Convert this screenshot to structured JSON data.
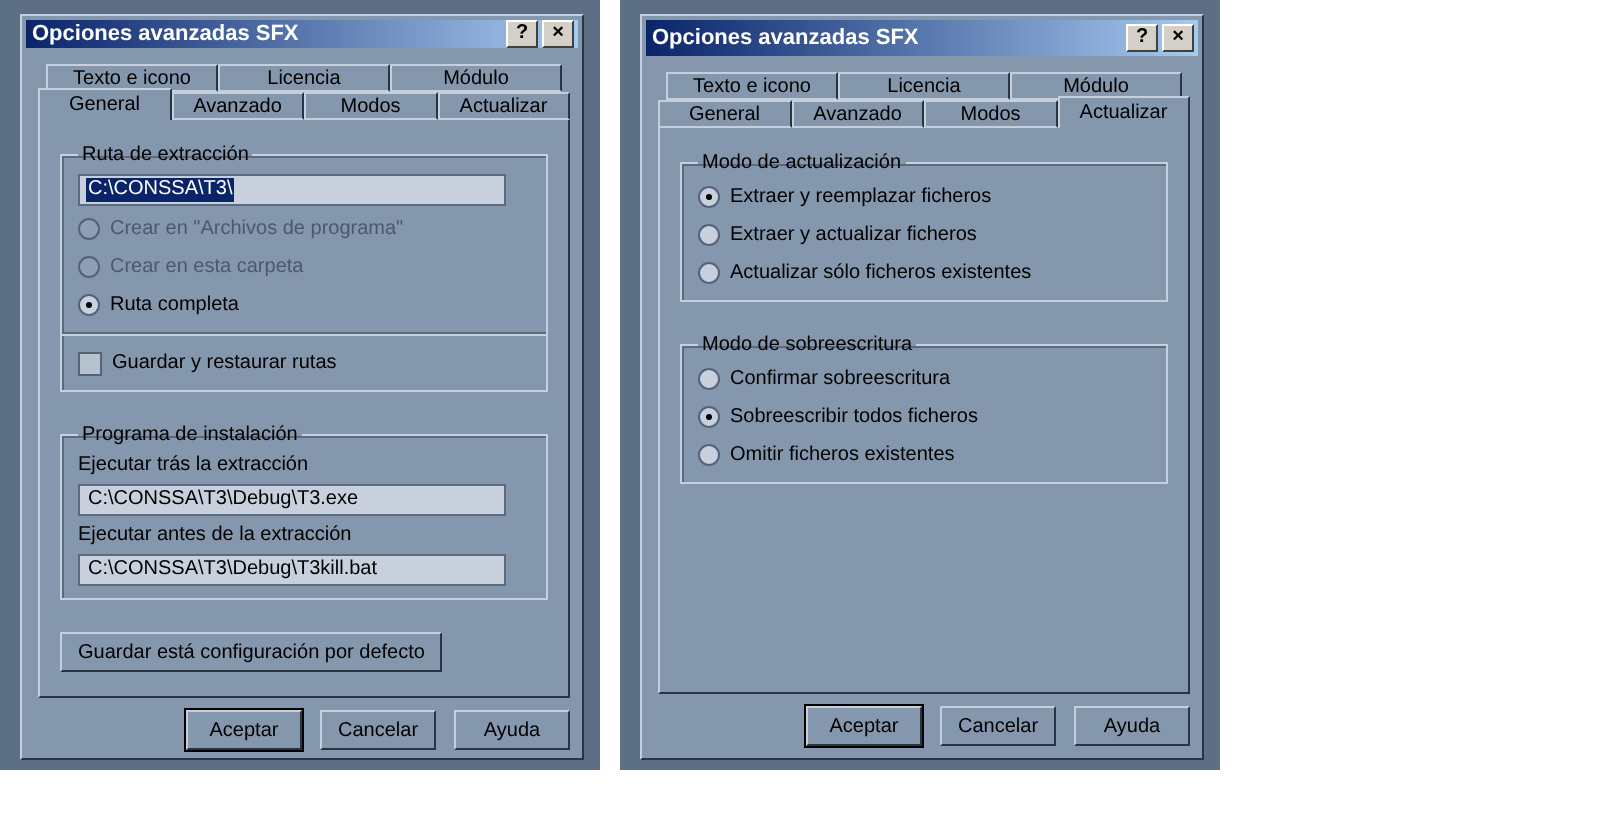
{
  "dialogs": [
    {
      "title": "Opciones avanzadas SFX",
      "title_buttons": [
        "?",
        "×"
      ],
      "tab_rows": [
        [
          {
            "label": "Texto e icono",
            "selected": false
          },
          {
            "label": "Licencia",
            "selected": false
          },
          {
            "label": "Módulo",
            "selected": false
          }
        ],
        [
          {
            "label": "General",
            "selected": true
          },
          {
            "label": "Avanzado",
            "selected": false
          },
          {
            "label": "Modos",
            "selected": false
          },
          {
            "label": "Actualizar",
            "selected": false
          }
        ]
      ],
      "content": [
        {
          "kind": "group",
          "title": "Ruta de extracción",
          "items": [
            {
              "kind": "field",
              "value": "C:\\CONSSA\\T3\\",
              "highlighted": true
            },
            {
              "kind": "radio",
              "label": "Crear en \"Archivos de programa\"",
              "selected": false,
              "disabled": true
            },
            {
              "kind": "radio",
              "label": "Crear en esta carpeta",
              "selected": false,
              "disabled": true
            },
            {
              "kind": "radio",
              "label": "Ruta completa",
              "selected": true,
              "disabled": false
            },
            {
              "kind": "separator"
            },
            {
              "kind": "checkbox",
              "label": "Guardar y restaurar rutas",
              "checked": false
            }
          ]
        },
        {
          "kind": "group",
          "title": "Programa de instalación",
          "items": [
            {
              "kind": "label",
              "label": "Ejecutar trás la extracción"
            },
            {
              "kind": "field",
              "value": "C:\\CONSSA\\T3\\Debug\\T3.exe",
              "highlighted": false
            },
            {
              "kind": "label",
              "label": "Ejecutar antes de la extracción"
            },
            {
              "kind": "field",
              "value": "C:\\CONSSA\\T3\\Debug\\T3kill.bat",
              "highlighted": false
            }
          ]
        },
        {
          "kind": "button",
          "label": "Guardar está configuración por defecto"
        }
      ],
      "buttons": [
        "Aceptar",
        "Cancelar",
        "Ayuda"
      ]
    },
    {
      "title": "Opciones avanzadas SFX",
      "title_buttons": [
        "?",
        "×"
      ],
      "tab_rows": [
        [
          {
            "label": "Texto e icono",
            "selected": false
          },
          {
            "label": "Licencia",
            "selected": false
          },
          {
            "label": "Módulo",
            "selected": false
          }
        ],
        [
          {
            "label": "General",
            "selected": false
          },
          {
            "label": "Avanzado",
            "selected": false
          },
          {
            "label": "Modos",
            "selected": false
          },
          {
            "label": "Actualizar",
            "selected": true
          }
        ]
      ],
      "content": [
        {
          "kind": "group",
          "title": "Modo de actualización",
          "items": [
            {
              "kind": "radio",
              "label": "Extraer y reemplazar ficheros",
              "selected": true,
              "disabled": false
            },
            {
              "kind": "radio",
              "label": "Extraer y actualizar ficheros",
              "selected": false,
              "disabled": false
            },
            {
              "kind": "radio",
              "label": "Actualizar sólo ficheros existentes",
              "selected": false,
              "disabled": false
            }
          ]
        },
        {
          "kind": "group",
          "title": "Modo de sobreescritura",
          "items": [
            {
              "kind": "radio",
              "label": "Confirmar sobreescritura",
              "selected": false,
              "disabled": false
            },
            {
              "kind": "radio",
              "label": "Sobreescribir todos ficheros",
              "selected": true,
              "disabled": false
            },
            {
              "kind": "radio",
              "label": "Omitir ficheros existentes",
              "selected": false,
              "disabled": false
            }
          ]
        }
      ],
      "buttons": [
        "Aceptar",
        "Cancelar",
        "Ayuda"
      ]
    }
  ]
}
